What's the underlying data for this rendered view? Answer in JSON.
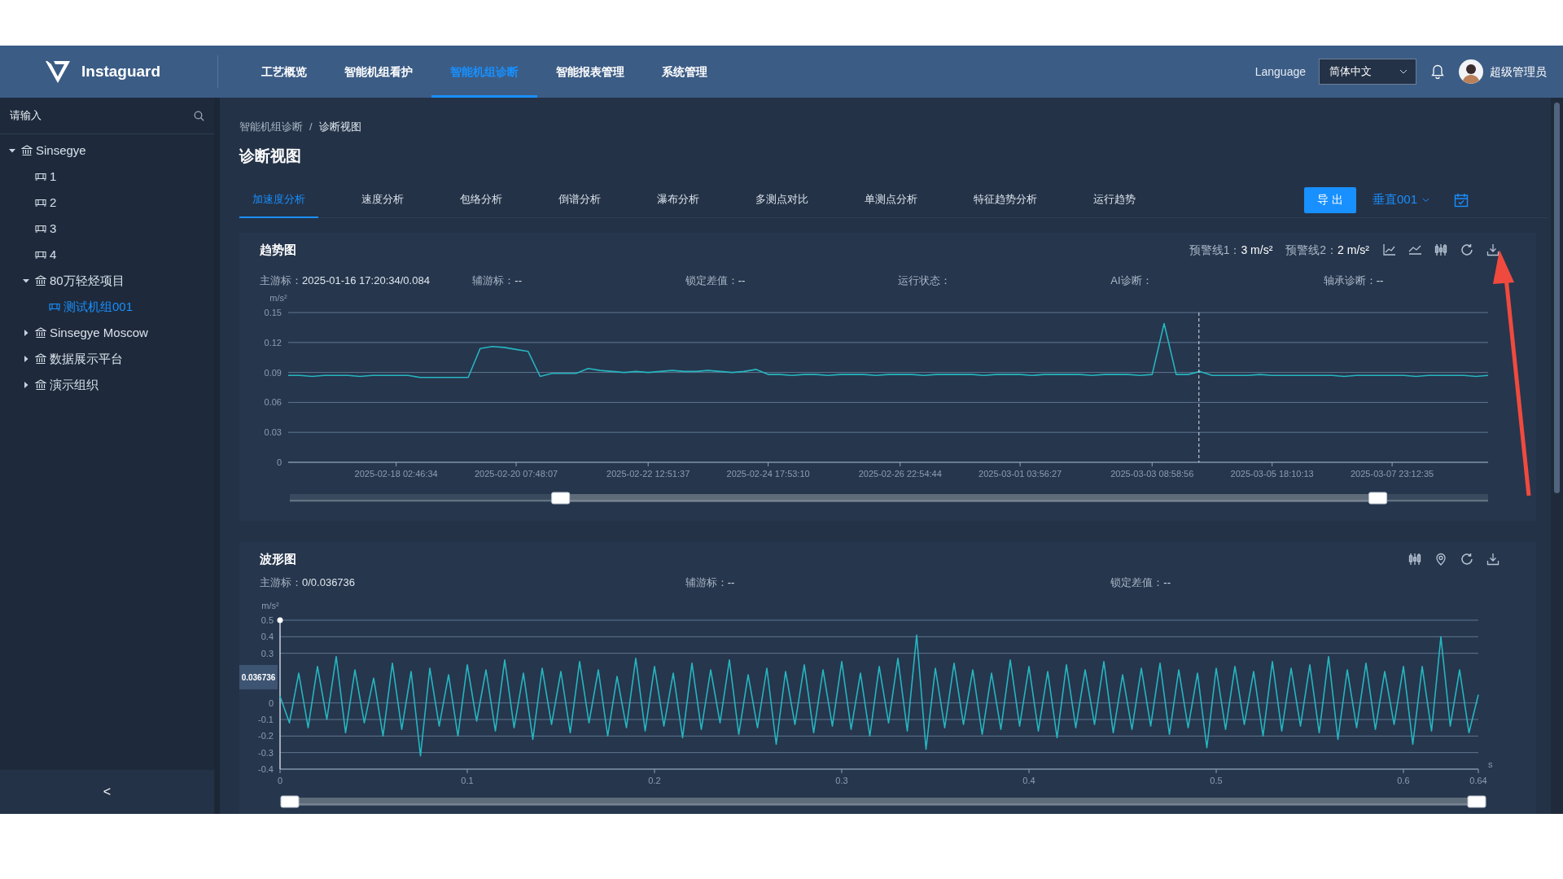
{
  "header": {
    "brand": "Instaguard",
    "nav": [
      {
        "label": "工艺概览",
        "selected": false
      },
      {
        "label": "智能机组看护",
        "selected": false
      },
      {
        "label": "智能机组诊断",
        "selected": true
      },
      {
        "label": "智能报表管理",
        "selected": false
      },
      {
        "label": "系统管理",
        "selected": false
      }
    ],
    "language_label": "Language",
    "language_value": "简体中文",
    "user": "超级管理员"
  },
  "sidebar": {
    "search": {
      "placeholder": "请输入"
    },
    "tree": [
      {
        "label": "Sinsegye",
        "kind": "org",
        "expanded": true,
        "selected": false,
        "children": [
          {
            "label": "1",
            "kind": "device",
            "expanded": false,
            "selected": false
          },
          {
            "label": "2",
            "kind": "device",
            "expanded": false,
            "selected": false
          },
          {
            "label": "3",
            "kind": "device",
            "expanded": false,
            "selected": false
          },
          {
            "label": "4",
            "kind": "device",
            "expanded": false,
            "selected": false
          },
          {
            "label": "80万轻烃项目",
            "kind": "org",
            "expanded": true,
            "selected": false,
            "children": [
              {
                "label": "测试机组001",
                "kind": "device",
                "expanded": false,
                "selected": true
              }
            ]
          },
          {
            "label": "Sinsegye Moscow",
            "kind": "org",
            "expanded": false,
            "selected": false
          },
          {
            "label": "数据展示平台",
            "kind": "org",
            "expanded": false,
            "selected": false
          },
          {
            "label": "演示组织",
            "kind": "org",
            "expanded": false,
            "selected": false
          }
        ]
      }
    ],
    "collapse": "<"
  },
  "breadcrumb": [
    "智能机组诊断",
    "诊断视图"
  ],
  "breadcrumb_separator": "/",
  "title": "诊断视图",
  "tabs": [
    {
      "label": "加速度分析",
      "selected": true
    },
    {
      "label": "速度分析",
      "selected": false
    },
    {
      "label": "包络分析",
      "selected": false
    },
    {
      "label": "倒谱分析",
      "selected": false
    },
    {
      "label": "瀑布分析",
      "selected": false
    },
    {
      "label": "多测点对比",
      "selected": false
    },
    {
      "label": "单测点分析",
      "selected": false
    },
    {
      "label": "特征趋势分析",
      "selected": false
    },
    {
      "label": "运行趋势",
      "selected": false
    }
  ],
  "export_button": "导 出",
  "point_select": "垂直001",
  "trend_panel": {
    "title": "趋势图",
    "warnings": [
      {
        "label": "预警线1：",
        "value": "3 m/s²"
      },
      {
        "label": "预警线2：",
        "value": "2 m/s²"
      }
    ],
    "info": [
      {
        "label": "主游标：",
        "value": "2025-01-16 17:20:34/0.084"
      },
      {
        "label": "辅游标：",
        "value": "--"
      },
      {
        "label": "锁定差值：",
        "value": "--"
      },
      {
        "label": "运行状态："
      },
      {
        "label": "AI诊断："
      },
      {
        "label": "轴承诊断：",
        "value": "--"
      }
    ],
    "chart_data": {
      "type": "line",
      "ylabel": "m/s²",
      "grid": true,
      "categories": [
        null,
        null,
        null,
        null,
        null,
        null,
        null,
        null,
        null,
        "2025-02-18 02:46:34",
        null,
        null,
        null,
        null,
        null,
        null,
        null,
        null,
        null,
        "2025-02-20 07:48:07",
        null,
        null,
        null,
        null,
        null,
        null,
        null,
        null,
        null,
        null,
        "2025-02-22 12:51:37",
        null,
        null,
        null,
        null,
        null,
        null,
        null,
        null,
        null,
        "2025-02-24 17:53:10",
        null,
        null,
        null,
        null,
        null,
        null,
        null,
        null,
        null,
        null,
        "2025-02-26 22:54:44",
        null,
        null,
        null,
        null,
        null,
        null,
        null,
        null,
        null,
        "2025-03-01 03:56:27",
        null,
        null,
        null,
        null,
        null,
        null,
        null,
        null,
        null,
        null,
        "2025-03-03 08:58:56",
        null,
        null,
        null,
        null,
        null,
        null,
        null,
        null,
        null,
        "2025-03-05 18:10:13",
        null,
        null,
        null,
        null,
        null,
        null,
        null,
        null,
        null,
        "2025-03-07 23:12:35",
        null,
        null,
        null,
        null,
        null,
        null,
        null,
        null
      ],
      "series": [
        {
          "color": "#26b5bf",
          "values": [
            0.087,
            0.087,
            0.086,
            0.087,
            0.087,
            0.087,
            0.086,
            0.087,
            0.087,
            0.087,
            0.087,
            0.085,
            0.085,
            0.085,
            0.085,
            0.085,
            0.114,
            0.116,
            0.115,
            0.113,
            0.111,
            0.086,
            0.089,
            0.089,
            0.089,
            0.094,
            0.092,
            0.091,
            0.09,
            0.091,
            0.09,
            0.091,
            0.092,
            0.091,
            0.091,
            0.092,
            0.091,
            0.09,
            0.091,
            0.093,
            0.088,
            0.088,
            0.087,
            0.088,
            0.088,
            0.087,
            0.088,
            0.088,
            0.088,
            0.087,
            0.088,
            0.088,
            0.088,
            0.087,
            0.088,
            0.088,
            0.088,
            0.088,
            0.087,
            0.088,
            0.088,
            0.088,
            0.087,
            0.088,
            0.088,
            0.088,
            0.088,
            0.087,
            0.088,
            0.088,
            0.088,
            0.087,
            0.088,
            0.139,
            0.088,
            0.088,
            0.091,
            0.087,
            0.087,
            0.087,
            0.087,
            0.088,
            0.087,
            0.087,
            0.087,
            0.087,
            0.087,
            0.087,
            0.086,
            0.087,
            0.087,
            0.087,
            0.087,
            0.087,
            0.086,
            0.087,
            0.087,
            0.087,
            0.087,
            0.086,
            0.087
          ]
        }
      ],
      "ylim": [
        0,
        0.15
      ],
      "yticks": [
        0,
        0.03,
        0.06,
        0.09,
        0.12,
        0.15
      ]
    },
    "slider": {
      "handles": [
        {
          "level": 0.226
        },
        {
          "level": 0.908
        }
      ]
    }
  },
  "wave_panel": {
    "title": "波形图",
    "info": [
      {
        "label": "主游标：",
        "value": "0/0.036736"
      },
      {
        "label": "辅游标：",
        "value": "--"
      },
      {
        "label": "锁定差值：",
        "value": "--"
      }
    ],
    "chart_data": {
      "type": "line",
      "ylabel": "m/s²",
      "xlabel": "s",
      "grid": true,
      "xlim": [
        0,
        0.64
      ],
      "ylim": [
        -0.4,
        0.5
      ],
      "yticks": [
        -0.4,
        -0.3,
        -0.2,
        -0.1,
        0,
        0.3,
        0.4,
        0.5
      ],
      "xticks": [
        0,
        0.1,
        0.2,
        0.3,
        0.4,
        0.5,
        0.6,
        0.64
      ],
      "x": [
        0,
        0.005,
        0.01,
        0.015,
        0.02,
        0.025,
        0.03,
        0.035,
        0.04,
        0.045,
        0.05,
        0.055,
        0.06,
        0.065,
        0.07,
        0.075,
        0.08,
        0.085,
        0.09,
        0.095,
        0.1,
        0.105,
        0.11,
        0.115,
        0.12,
        0.125,
        0.13,
        0.135,
        0.14,
        0.145,
        0.15,
        0.155,
        0.16,
        0.165,
        0.17,
        0.175,
        0.18,
        0.185,
        0.19,
        0.195,
        0.2,
        0.205,
        0.21,
        0.215,
        0.22,
        0.225,
        0.23,
        0.235,
        0.24,
        0.245,
        0.25,
        0.255,
        0.26,
        0.265,
        0.27,
        0.275,
        0.28,
        0.285,
        0.29,
        0.295,
        0.3,
        0.305,
        0.31,
        0.315,
        0.32,
        0.325,
        0.33,
        0.335,
        0.34,
        0.345,
        0.35,
        0.355,
        0.36,
        0.365,
        0.37,
        0.375,
        0.38,
        0.385,
        0.39,
        0.395,
        0.4,
        0.405,
        0.41,
        0.415,
        0.42,
        0.425,
        0.43,
        0.435,
        0.44,
        0.445,
        0.45,
        0.455,
        0.46,
        0.465,
        0.47,
        0.475,
        0.48,
        0.485,
        0.49,
        0.495,
        0.5,
        0.505,
        0.51,
        0.515,
        0.52,
        0.525,
        0.53,
        0.535,
        0.54,
        0.545,
        0.55,
        0.555,
        0.56,
        0.565,
        0.57,
        0.575,
        0.58,
        0.585,
        0.59,
        0.595,
        0.6,
        0.605,
        0.61,
        0.615,
        0.62,
        0.625,
        0.63,
        0.635,
        0.64
      ],
      "series": [
        {
          "color": "#26b5bf",
          "values": [
            0.04,
            -0.12,
            0.18,
            -0.15,
            0.22,
            -0.1,
            0.28,
            -0.18,
            0.2,
            -0.12,
            0.15,
            -0.2,
            0.24,
            -0.16,
            0.19,
            -0.32,
            0.21,
            -0.14,
            0.17,
            -0.2,
            0.23,
            -0.11,
            0.2,
            -0.17,
            0.26,
            -0.15,
            0.18,
            -0.22,
            0.21,
            -0.13,
            0.19,
            -0.18,
            0.25,
            -0.12,
            0.2,
            -0.2,
            0.16,
            -0.15,
            0.27,
            -0.17,
            0.22,
            -0.14,
            0.18,
            -0.21,
            0.24,
            -0.16,
            0.2,
            -0.12,
            0.26,
            -0.19,
            0.17,
            -0.15,
            0.21,
            -0.25,
            0.19,
            -0.13,
            0.23,
            -0.18,
            0.2,
            -0.14,
            0.25,
            -0.16,
            0.18,
            -0.2,
            0.22,
            -0.12,
            0.27,
            -0.17,
            0.41,
            -0.28,
            0.21,
            -0.15,
            0.24,
            -0.13,
            0.2,
            -0.19,
            0.18,
            -0.16,
            0.26,
            -0.14,
            0.22,
            -0.17,
            0.19,
            -0.21,
            0.23,
            -0.15,
            0.2,
            -0.13,
            0.25,
            -0.18,
            0.17,
            -0.16,
            0.21,
            -0.14,
            0.24,
            -0.19,
            0.2,
            -0.15,
            0.18,
            -0.27,
            0.21,
            -0.16,
            0.22,
            -0.13,
            0.19,
            -0.2,
            0.25,
            -0.17,
            0.21,
            -0.14,
            0.23,
            -0.18,
            0.28,
            -0.22,
            0.2,
            -0.15,
            0.24,
            -0.16,
            0.19,
            -0.13,
            0.22,
            -0.25,
            0.22,
            -0.17,
            0.4,
            -0.14,
            0.2,
            -0.18,
            0.05
          ]
        }
      ],
      "annotations": [
        {
          "text": "0.036736"
        }
      ]
    },
    "slider": {
      "handles": [
        {
          "level": 0
        },
        {
          "level": 1
        }
      ]
    }
  }
}
